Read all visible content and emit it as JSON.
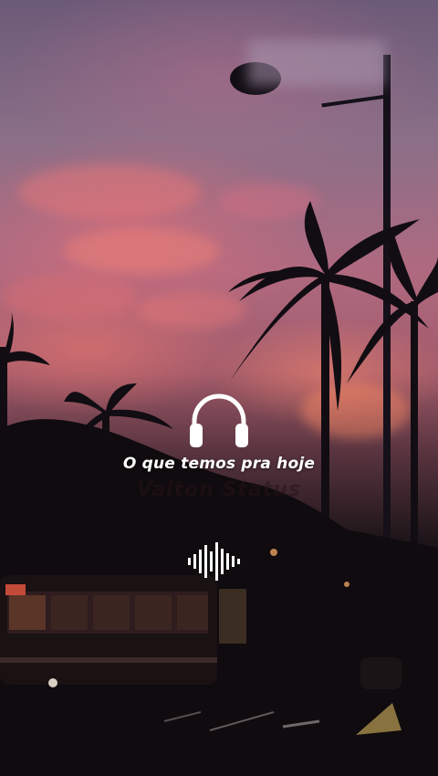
{
  "lyric": "O que temos pra hoje",
  "watermark": "Valton Status",
  "icons": {
    "headphones": "headphones-icon",
    "audio_wave": "audio-wave-icon"
  },
  "colors": {
    "sky_top": "#6b5a78",
    "sky_glow": "#b06a80",
    "ground": "#0e0b0d",
    "text": "#ffffff"
  }
}
